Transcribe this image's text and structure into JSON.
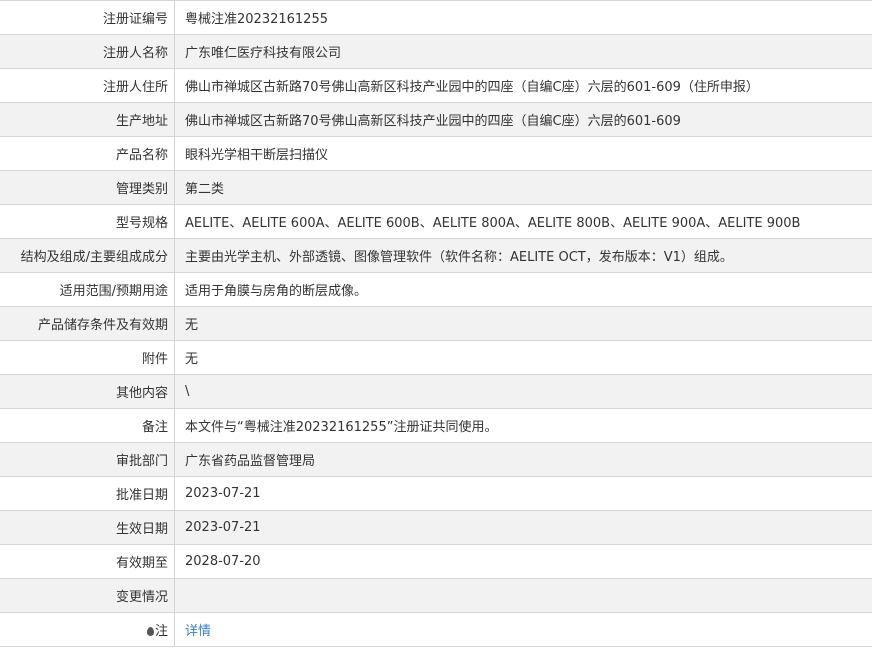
{
  "rows": [
    {
      "label": "注册证编号",
      "value": "粤械注准20232161255"
    },
    {
      "label": "注册人名称",
      "value": "广东唯仁医疗科技有限公司"
    },
    {
      "label": "注册人住所",
      "value": "佛山市禅城区古新路70号佛山高新区科技产业园中的四座（自编C座）六层的601-609（住所申报）"
    },
    {
      "label": "生产地址",
      "value": "佛山市禅城区古新路70号佛山高新区科技产业园中的四座（自编C座）六层的601-609"
    },
    {
      "label": "产品名称",
      "value": "眼科光学相干断层扫描仪"
    },
    {
      "label": "管理类别",
      "value": "第二类"
    },
    {
      "label": "型号规格",
      "value": "AELITE、AELITE 600A、AELITE 600B、AELITE 800A、AELITE 800B、AELITE 900A、AELITE 900B"
    },
    {
      "label": "结构及组成/主要组成成分",
      "value": "主要由光学主机、外部透镜、图像管理软件（软件名称：AELITE OCT，发布版本：V1）组成。"
    },
    {
      "label": "适用范围/预期用途",
      "value": "适用于角膜与房角的断层成像。"
    },
    {
      "label": "产品储存条件及有效期",
      "value": "无"
    },
    {
      "label": "附件",
      "value": "无"
    },
    {
      "label": "其他内容",
      "value": "\\"
    },
    {
      "label": "备注",
      "value": "本文件与“粤械注准20232161255”注册证共同使用。"
    },
    {
      "label": "审批部门",
      "value": "广东省药品监督管理局"
    },
    {
      "label": "批准日期",
      "value": "2023-07-21"
    },
    {
      "label": "生效日期",
      "value": "2023-07-21"
    },
    {
      "label": "有效期至",
      "value": "2028-07-20"
    },
    {
      "label": "变更情况",
      "value": ""
    }
  ],
  "note_row": {
    "label": "注",
    "icon": "pin-icon",
    "link_text": "详情"
  },
  "colors": {
    "shaded_row": "#f2f2f2",
    "border": "#d6d6d6",
    "link": "#3a7fc7"
  }
}
